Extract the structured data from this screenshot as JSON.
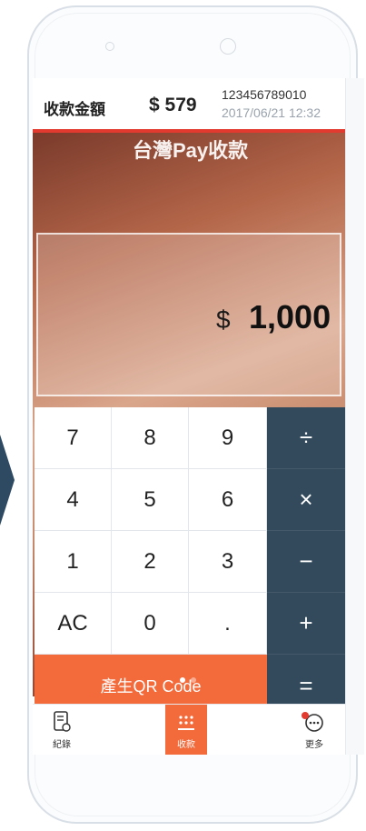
{
  "header": {
    "label": "收款金額",
    "amount": "$ 579",
    "merchant_id": "123456789010",
    "datetime": "2017/06/21 12:32"
  },
  "banner": {
    "title": "台灣Pay收款"
  },
  "amount_display": {
    "currency": "$",
    "value": "1,000"
  },
  "keypad": {
    "keys": {
      "k7": "7",
      "k8": "8",
      "k9": "9",
      "div": "÷",
      "k4": "4",
      "k5": "5",
      "k6": "6",
      "mul": "×",
      "k1": "1",
      "k2": "2",
      "k3": "3",
      "sub": "−",
      "ac": "AC",
      "k0": "0",
      "dot": ".",
      "add": "+",
      "qr": "產生QR Code",
      "eq": "="
    }
  },
  "tabs": {
    "records": "紀錄",
    "collect": "收款",
    "more": "更多"
  },
  "colors": {
    "accent": "#f36a3b",
    "op": "#334a5c",
    "alert": "#e33a2f"
  }
}
